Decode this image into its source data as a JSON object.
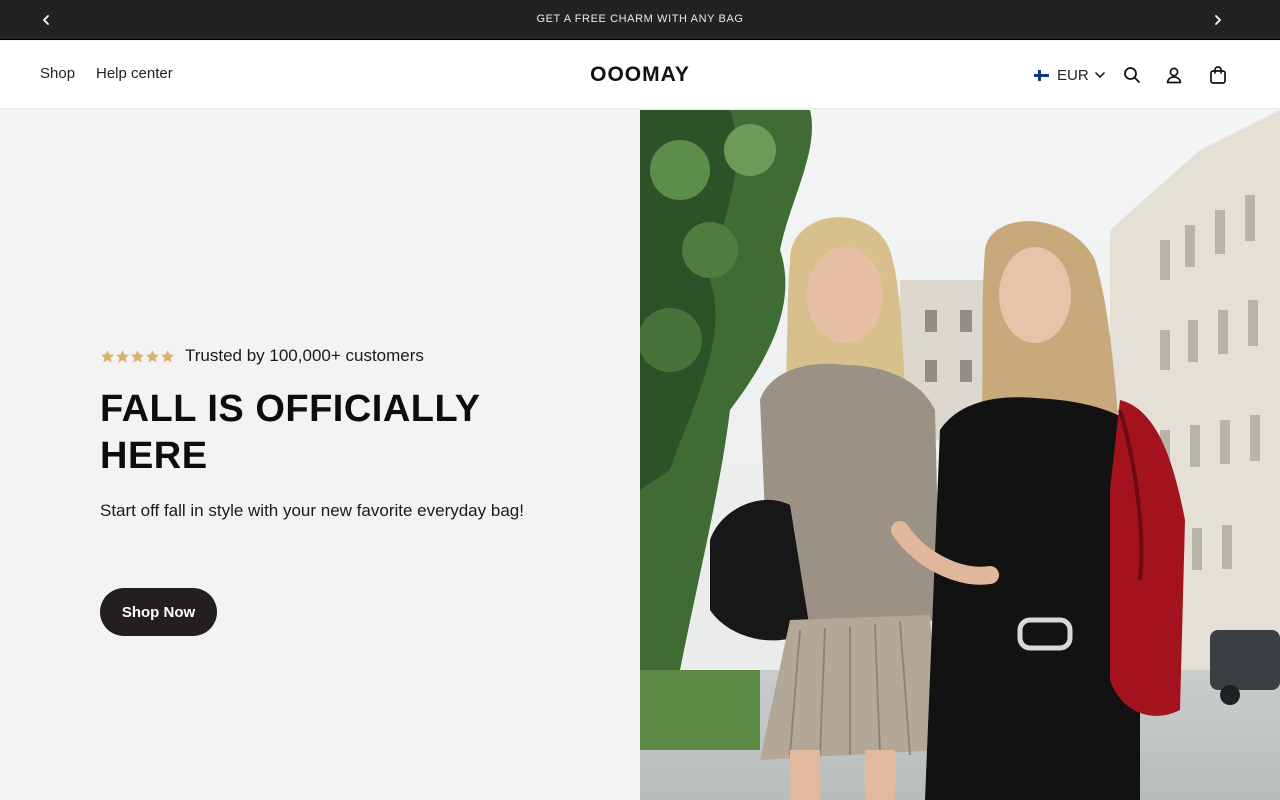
{
  "announcement": {
    "text": "GET A FREE CHARM WITH ANY BAG",
    "prev_icon": "chevron-left-icon",
    "next_icon": "chevron-right-icon"
  },
  "header": {
    "nav": {
      "shop": "Shop",
      "help": "Help center"
    },
    "logo": "OOOMAY",
    "currency": {
      "flag": "finland-flag-icon",
      "label": "EUR"
    },
    "icons": [
      "search-icon",
      "account-icon",
      "shopping-bag-icon"
    ]
  },
  "hero": {
    "rating": {
      "stars": 5,
      "star_color": "#d9b26c",
      "text": "Trusted by 100,000+ customers"
    },
    "headline": "FALL IS OFFICIALLY HERE",
    "subtext": "Start off fall in style with your new favorite everyday bag!",
    "cta": "Shop Now"
  },
  "colors": {
    "announcement_bg": "#222222",
    "hero_bg": "#f3f3f3",
    "cta_bg": "#231f20"
  }
}
